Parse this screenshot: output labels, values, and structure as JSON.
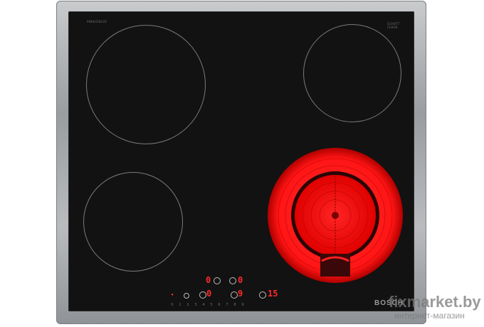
{
  "product": {
    "brand": "BOSCH",
    "glass_label_top_right_line1": "SCHOTT",
    "glass_label_top_right_line2": "CERAN",
    "model_tag": "PKN645BA2E"
  },
  "controls": {
    "display_left_top": "0",
    "display_right_top": "0",
    "display_left_bottom": "0",
    "display_mid_bottom": "9",
    "display_right": "15",
    "scale_digits": [
      "0",
      "1",
      "2",
      "3",
      "4",
      "5",
      "6",
      "7",
      "8",
      "9"
    ]
  },
  "watermark": {
    "main": "fixmarket.by",
    "sub": "интернет-магазин"
  },
  "colors": {
    "glass": "#121212",
    "heated_zone": "#ff1a1a",
    "frame": "#a7aaad"
  }
}
